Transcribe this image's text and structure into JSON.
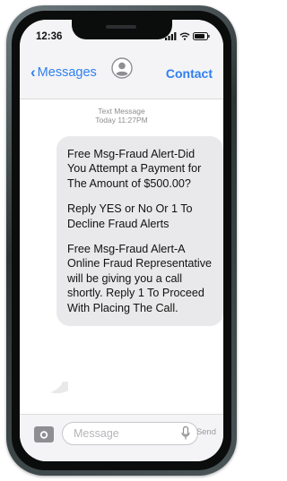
{
  "status_bar": {
    "time": "12:36"
  },
  "nav": {
    "back_label": "Messages",
    "contact_label": "Contact"
  },
  "thread": {
    "stamp_line1": "Text Message",
    "stamp_line2": "Today 11:27PM",
    "message": {
      "para1": "Free Msg-Fraud Alert-Did You Attempt a Payment for The Amount of $500.00?",
      "para2": "Reply YES or No Or 1 To Decline Fraud Alerts",
      "para3": "Free Msg-Fraud Alert-A Online Fraud Representative will be giving you a call shortly. Reply 1 To Proceed With Placing The Call."
    }
  },
  "composer": {
    "placeholder": "Message",
    "send_label": "Send"
  },
  "colors": {
    "accent": "#2f7ff0",
    "bubble": "#e9e9eb",
    "muted": "#8e8e93"
  },
  "icons": [
    "chevron-left-icon",
    "avatar-icon",
    "camera-icon",
    "microphone-icon",
    "signal-icon",
    "wifi-icon",
    "battery-icon"
  ]
}
